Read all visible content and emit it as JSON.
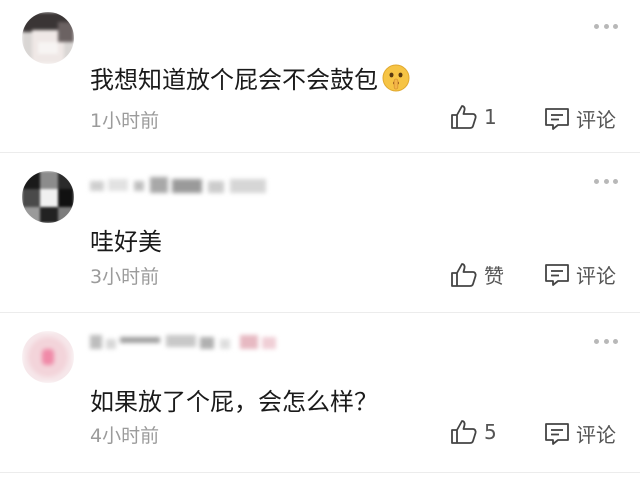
{
  "comments": [
    {
      "text": "我想知道放个屁会不会鼓包",
      "time": "1小时前",
      "like_label": "1",
      "reply_label": "评论",
      "has_emoji": true
    },
    {
      "text": "哇好美",
      "time": "3小时前",
      "like_label": "赞",
      "reply_label": "评论"
    },
    {
      "text": "如果放了个屁，会怎么样？",
      "time": "4小时前",
      "like_label": "5",
      "reply_label": "评论"
    }
  ]
}
